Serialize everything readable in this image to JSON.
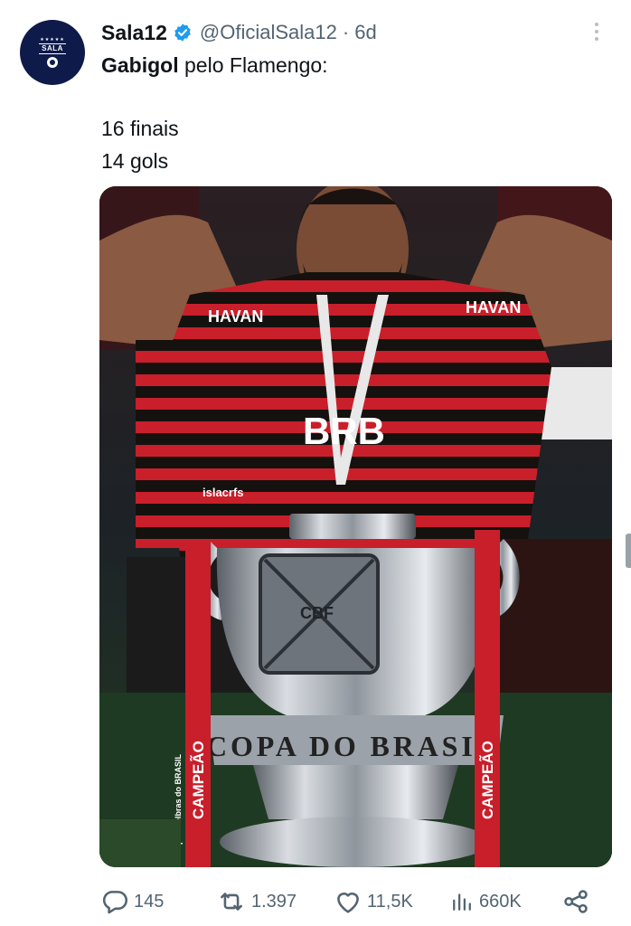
{
  "tweet": {
    "avatar": {
      "text": "SALA",
      "stars": "★★★★★",
      "color": "#0d1a4a"
    },
    "author": {
      "display_name": "Sala12",
      "handle": "@OficialSala12",
      "separator": "·",
      "age": "6d",
      "verified": true,
      "verified_color": "#1d9bf0"
    },
    "text": {
      "bold_name": "Gabigol",
      "line1_rest": " pelo Flamengo:",
      "line2": "16 finais",
      "line3": "14 gols"
    },
    "media": {
      "description_icon": "photo-icon",
      "shirt_sponsor_chest": "BRB",
      "shirt_sponsor_shoulder": "HAVAN",
      "watermark": "islacrfs",
      "trophy_ribbon": "CAMPEÃO",
      "trophy_ribbon_sub": "Copa Intelbras do BRASIL",
      "trophy_band": "COPA DO BRASIL",
      "trophy_badge": "CBF"
    },
    "actions": {
      "replies": "145",
      "reposts": "1.397",
      "likes": "11,5K",
      "views": "660K"
    },
    "colors": {
      "text_primary": "#0f1419",
      "text_secondary": "#536471"
    }
  }
}
